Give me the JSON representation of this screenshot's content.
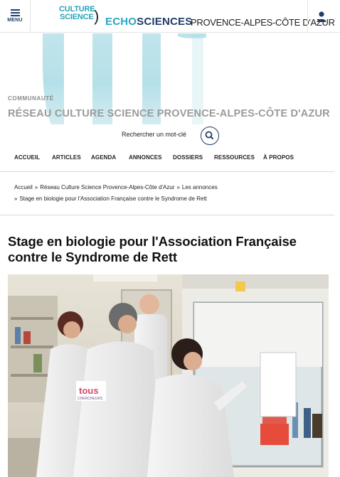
{
  "header": {
    "menu_label": "MENU",
    "logo_line1": "CULTURE",
    "logo_line2": "SCIENCE",
    "brand_echo": "ECHO",
    "brand_sciences": "SCIENCES",
    "brand_region": "PROVENCE-ALPES-CÔTE D'AZUR"
  },
  "community": {
    "label": "COMMUNAUTÉ",
    "title": "RÉSEAU CULTURE SCIENCE PROVENCE-ALPES-CÔTE D'AZUR"
  },
  "search": {
    "label": "Rechercher un mot-clé"
  },
  "nav": {
    "items": [
      "ACCUEIL",
      "ARTICLES",
      "AGENDA",
      "ANNONCES",
      "DOSSIERS",
      "RESSOURCES",
      "À PROPOS"
    ]
  },
  "breadcrumb": {
    "items": [
      "Accueil",
      "Réseau Culture Science Provence-Alpes-Côte d'Azur",
      "Les annonces",
      "Stage en biologie pour l'Association Française contre le Syndrome de Rett"
    ],
    "separator": "»"
  },
  "article": {
    "title": "Stage en biologie pour l'Association Française contre le Syndrome de Rett",
    "coat_print_1": "tous",
    "coat_print_2": "CHERCHEURS"
  },
  "colors": {
    "brand_navy": "#1f3c66",
    "brand_teal": "#29a6c2"
  }
}
